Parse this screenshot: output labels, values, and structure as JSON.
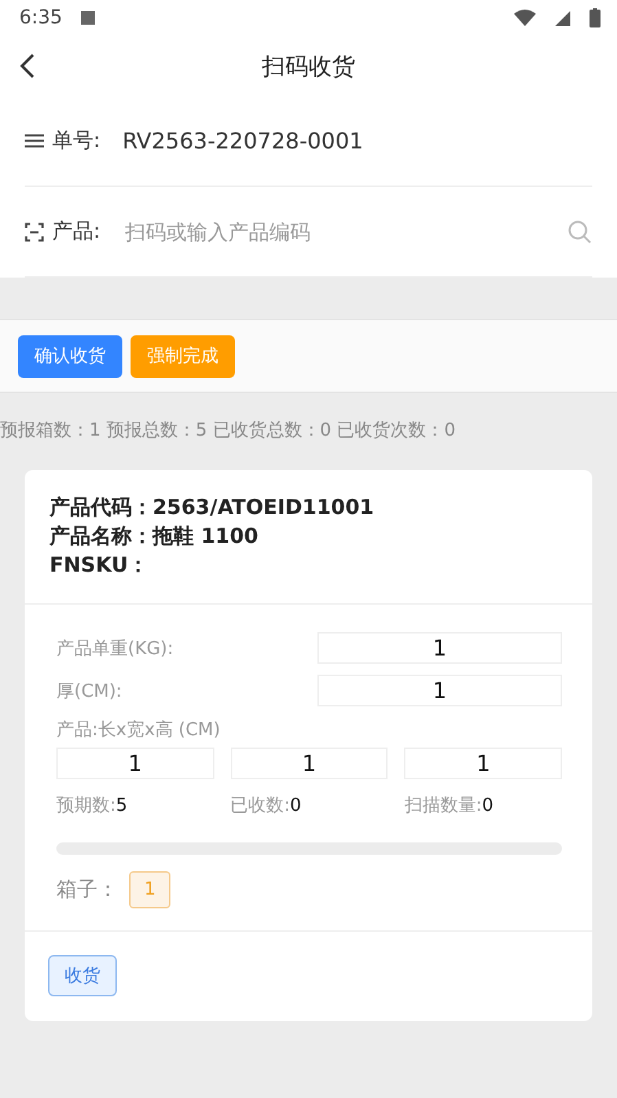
{
  "status_bar": {
    "time": "6:35"
  },
  "header": {
    "title": "扫码收货"
  },
  "order": {
    "label": "单号:",
    "value": "RV2563-220728-0001"
  },
  "product_search": {
    "label": "产品:",
    "placeholder": "扫码或输入产品编码"
  },
  "actions": [
    {
      "label": "确认收货",
      "kind": "primary"
    },
    {
      "label": "强制完成",
      "kind": "warning"
    }
  ],
  "summary": "预报箱数：1 预报总数：5 已收货总数：0 已收货次数：0",
  "card": {
    "lines": [
      "产品代码：2563/ATOEID11001",
      "产品名称：拖鞋 1100",
      "FNSKU："
    ],
    "weight": {
      "label": "产品单重(KG):",
      "value": "1"
    },
    "thickness": {
      "label": "厚(CM):",
      "value": "1"
    },
    "dimensions": {
      "label": "产品:长x宽x高 (CM)",
      "values": [
        "1",
        "1",
        "1"
      ]
    },
    "counts": [
      {
        "label": "预期数:",
        "value": "5"
      },
      {
        "label": "已收数:",
        "value": "0"
      },
      {
        "label": "扫描数量:",
        "value": "0"
      }
    ],
    "progress": {
      "level": 0
    },
    "boxes": {
      "label": "箱子：",
      "items": [
        "1"
      ]
    },
    "receive_button": "收货"
  }
}
